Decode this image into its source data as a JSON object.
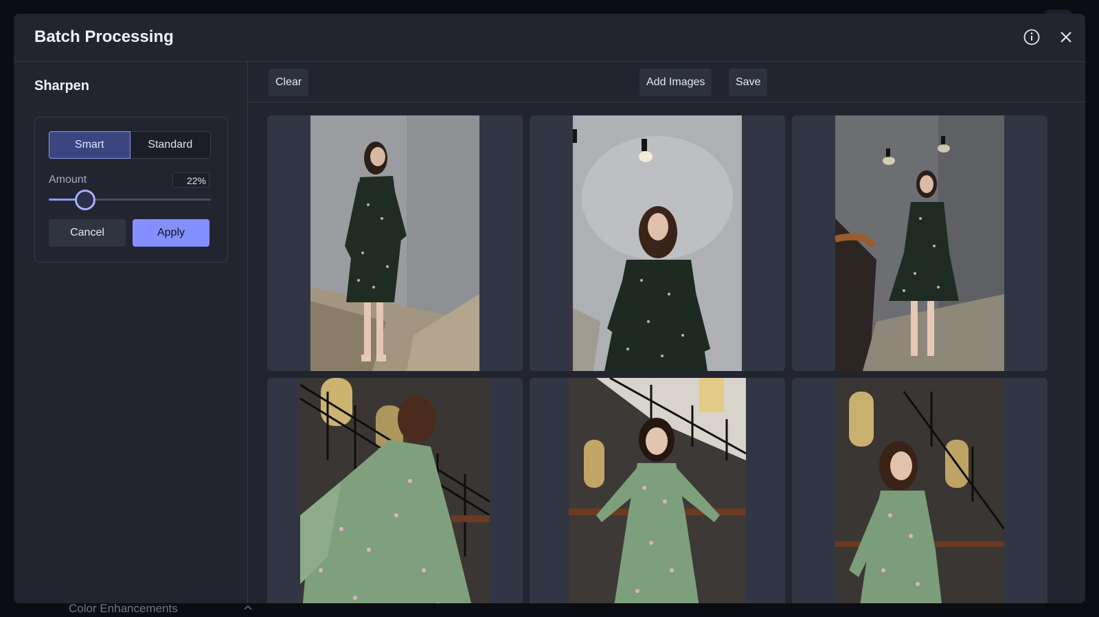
{
  "backdrop": {
    "section_label": "Color Enhancements"
  },
  "modal": {
    "title": "Batch Processing",
    "info_icon": "info-icon",
    "close_icon": "close-icon"
  },
  "sidebar": {
    "section_title": "Sharpen",
    "modes": [
      {
        "label": "Smart",
        "active": true
      },
      {
        "label": "Standard",
        "active": false
      }
    ],
    "amount": {
      "label": "Amount",
      "value_text": "22%",
      "value": 0.22
    },
    "cancel_label": "Cancel",
    "apply_label": "Apply"
  },
  "toolbar": {
    "clear_label": "Clear",
    "add_images_label": "Add Images",
    "save_label": "Save"
  },
  "colors": {
    "accent": "#8490ff",
    "modal_bg": "#22252f",
    "tile_bg": "#323644"
  },
  "images": [
    {
      "name": "photo-1",
      "dress": "dark-green floral",
      "setting": "stairwell, grey wall"
    },
    {
      "name": "photo-2",
      "dress": "dark-green floral",
      "setting": "grey wall, wall lamp"
    },
    {
      "name": "photo-3",
      "dress": "dark-green floral",
      "setting": "staircase with wall lamps"
    },
    {
      "name": "photo-4",
      "dress": "light-green floral",
      "setting": "stairwell railing, arched windows"
    },
    {
      "name": "photo-5",
      "dress": "light-green floral",
      "setting": "staircase, arched windows"
    },
    {
      "name": "photo-6",
      "dress": "light-green floral",
      "setting": "stairwell, arched windows"
    }
  ]
}
